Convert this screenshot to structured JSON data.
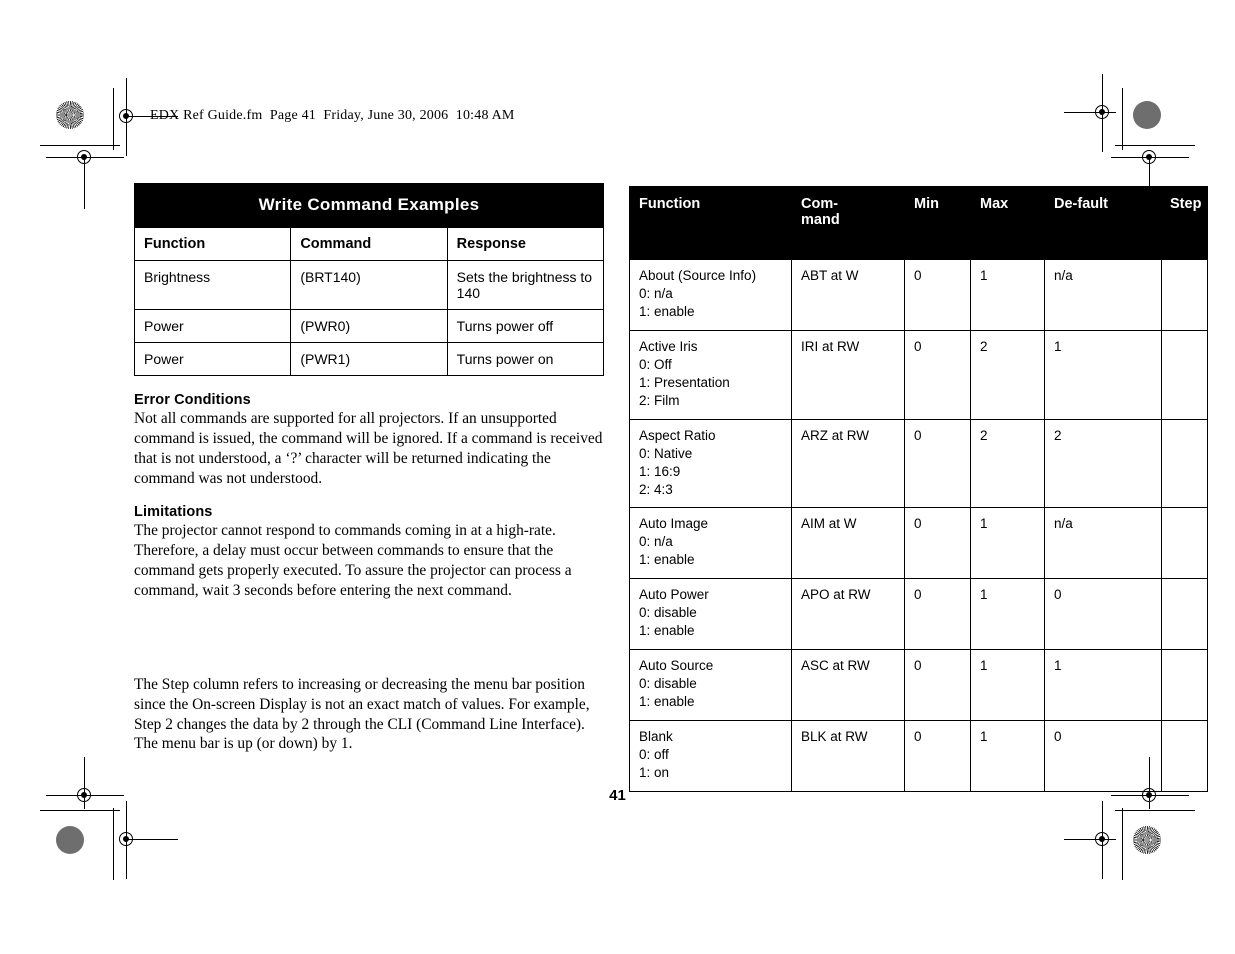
{
  "page": {
    "running_header": "EDX Ref Guide.fm  Page 41  Friday, June 30, 2006  10:48 AM",
    "folio": "41",
    "ink_black": "#000000",
    "paper_white": "#ffffff",
    "mark_gray": "#6e6e6e"
  },
  "write_table": {
    "title": "Write Command Examples",
    "columns": [
      "Function",
      "Command",
      "Response"
    ],
    "rows": [
      {
        "function": "Brightness",
        "command": "(BRT140)",
        "response": "Sets the brightness to 140"
      },
      {
        "function": "Power",
        "command": "(PWR0)",
        "response": "Turns power off"
      },
      {
        "function": "Power",
        "command": "(PWR1)",
        "response": "Turns power on"
      }
    ]
  },
  "error_conditions": {
    "heading": "Error Conditions",
    "body": "Not all commands are supported for all projectors. If an unsupported command is issued, the command will be ignored. If a command is received that is not understood, a ‘?’ character will be returned indicating the command was not understood."
  },
  "limitations": {
    "heading": "Limitations",
    "body": "The projector cannot respond to commands coming in at a high-rate. Therefore, a delay must occur between commands to ensure that the command gets properly executed. To assure the projector can process a command, wait 3 seconds before entering the next command."
  },
  "step_note": {
    "body": "The Step column refers to increasing or decreasing the menu bar position since the On-screen Display is not an exact match of values. For example, Step 2 changes the data by 2 through the CLI (Command Line Interface). The menu bar is up (or down) by 1."
  },
  "command_table": {
    "columns": {
      "function": "Function",
      "command_line1": "Com-",
      "command_line2": "mand",
      "min": "Min",
      "max": "Max",
      "default": "De-fault",
      "step": "Step"
    },
    "rows": [
      {
        "function": "About (Source Info)",
        "options": [
          "0: n/a",
          "1: enable"
        ],
        "command": "ABT at W",
        "min": "0",
        "max": "1",
        "default": "n/a",
        "step": ""
      },
      {
        "function": "Active Iris",
        "options": [
          "0: Off",
          "1: Presentation",
          "2: Film"
        ],
        "command": "IRI at RW",
        "min": "0",
        "max": "2",
        "default": "1",
        "step": ""
      },
      {
        "function": "Aspect Ratio",
        "options": [
          "0: Native",
          "1: 16:9",
          "2: 4:3"
        ],
        "command": "ARZ at RW",
        "min": "0",
        "max": "2",
        "default": "2",
        "step": ""
      },
      {
        "function": "Auto Image",
        "options": [
          "0: n/a",
          "1: enable"
        ],
        "command": "AIM at W",
        "min": "0",
        "max": "1",
        "default": "n/a",
        "step": ""
      },
      {
        "function": "Auto Power",
        "options": [
          "0: disable",
          "1: enable"
        ],
        "command": "APO at RW",
        "min": "0",
        "max": "1",
        "default": "0",
        "step": ""
      },
      {
        "function": "Auto Source",
        "options": [
          "0: disable",
          "1: enable"
        ],
        "command": "ASC at RW",
        "min": "0",
        "max": "1",
        "default": "1",
        "step": ""
      },
      {
        "function": "Blank",
        "options": [
          "0: off",
          "1: on"
        ],
        "command": "BLK at RW",
        "min": "0",
        "max": "1",
        "default": "0",
        "step": ""
      }
    ]
  }
}
